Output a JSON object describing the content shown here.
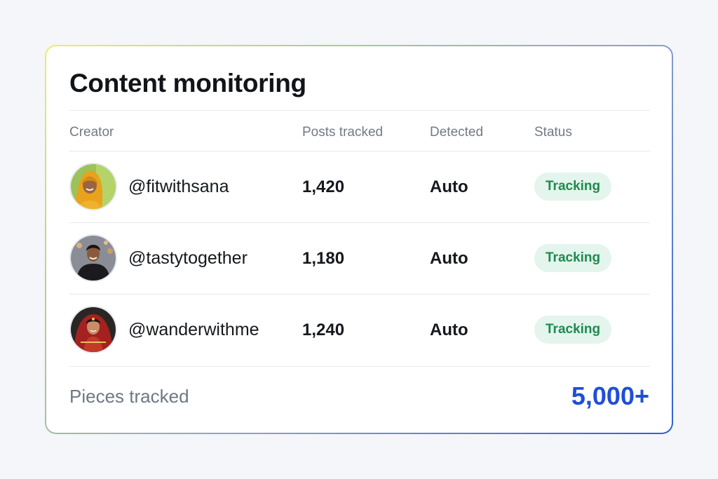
{
  "card": {
    "title": "Content monitoring",
    "columns": {
      "creator": "Creator",
      "posts": "Posts tracked",
      "detected": "Detected",
      "status": "Status"
    },
    "rows": [
      {
        "handle": "@fitwithsana",
        "posts": "1,420",
        "detected": "Auto",
        "status": "Tracking"
      },
      {
        "handle": "@tastytogether",
        "posts": "1,180",
        "detected": "Auto",
        "status": "Tracking"
      },
      {
        "handle": "@wanderwithme",
        "posts": "1,240",
        "detected": "Auto",
        "status": "Tracking"
      }
    ],
    "footer": {
      "label": "Pieces tracked",
      "value": "5,000+"
    }
  },
  "colors": {
    "accent": "#1f4fd8",
    "status_text": "#1e8a4e",
    "status_bg": "#e3f5ec"
  }
}
